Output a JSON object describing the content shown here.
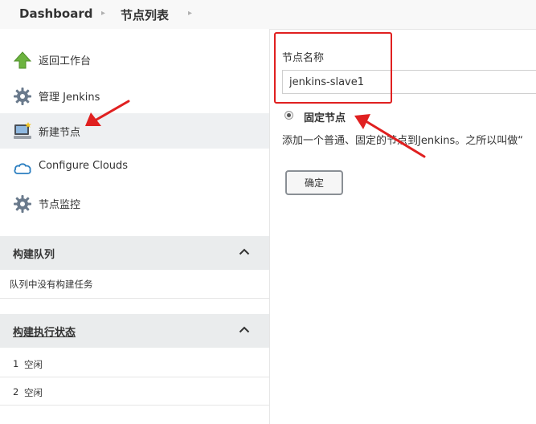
{
  "breadcrumb": {
    "items": [
      "Dashboard",
      "节点列表"
    ],
    "separator": "▸"
  },
  "sidebar": {
    "tasks": [
      {
        "label": "返回工作台",
        "icon": "up-arrow-icon"
      },
      {
        "label": "管理 Jenkins",
        "icon": "gear-icon"
      },
      {
        "label": "新建节点",
        "icon": "computer-icon"
      },
      {
        "label": "Configure Clouds",
        "icon": "cloud-icon"
      },
      {
        "label": "节点监控",
        "icon": "gear-icon"
      }
    ],
    "active_task": "新建节点",
    "build_queue": {
      "title": "构建队列",
      "empty_text": "队列中没有构建任务"
    },
    "executors": {
      "title": "构建执行状态",
      "rows": [
        {
          "index": "1",
          "status": "空闲"
        },
        {
          "index": "2",
          "status": "空闲"
        }
      ]
    }
  },
  "form": {
    "name_label": "节点名称",
    "name_value": "jenkins-slave1",
    "radio_label": "固定节点",
    "radio_description": "添加一个普通、固定的节点到Jenkins。之所以叫做“",
    "ok_label": "确定"
  },
  "colors": {
    "annotation": "#e02020",
    "active_row": "#eef0f2",
    "pane_header": "#eaeced",
    "up_arrow": "#6cb33f",
    "cloud": "#2c7fc1"
  }
}
